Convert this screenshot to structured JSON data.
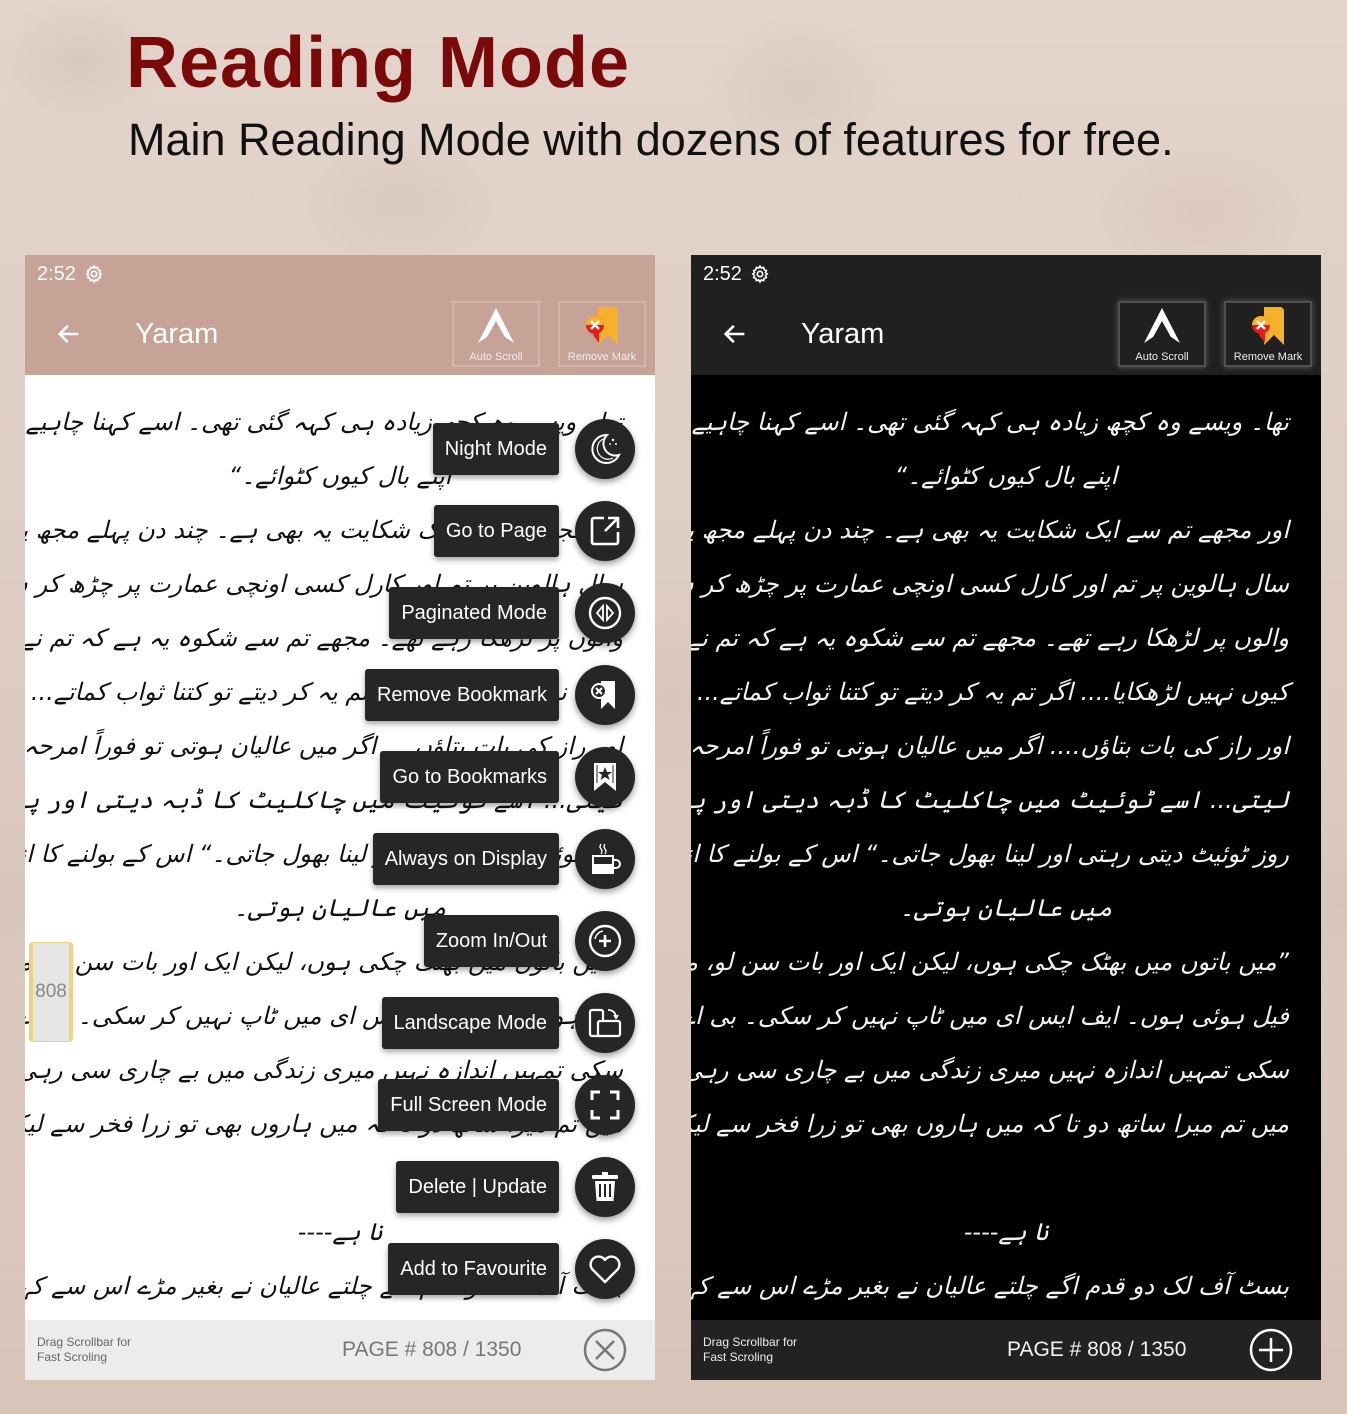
{
  "promo": {
    "headline": "Reading Mode",
    "subline": "Main Reading Mode with dozens of features for free."
  },
  "colors": {
    "headline": "#7a0a0a",
    "light_toolbar": "#c6a297",
    "dark_toolbar": "#202020",
    "fab_bg": "#262626",
    "scroll_thumb_accent": "#f0cf7e"
  },
  "light_screen": {
    "status": {
      "time": "2:52",
      "icon": "gear-icon"
    },
    "toolbar": {
      "back_icon": "arrow-left-icon",
      "title": "Yaram",
      "auto_scroll_label": "Auto Scroll",
      "remove_mark_label": "Remove Mark"
    },
    "paragraphs": [
      "تھا۔ ویسے وہ کچھ زیادہ ہی کہہ گئی تھی۔ اسے کہنا چاہیے تھا ”کارل کا سر کٹوا دیتے",
      "اپنے بال کیوں کٹوائے۔“",
      "اور مجھے تم سے ایک شکایت یہ بھی ہے۔ چند دن پہلے مجھ پر انکشاف ہوا کہ پچھلے",
      "سال ہالوین پر تم اور کارل کسی اونچی عمارت پر چڑھ کر ہالوین کدو آنے جانے",
      "والوں پر لڑھکا رہے تھے۔ مجھے تم سے شکوہ یہ ہے کہ تم نے کارل کو اوپر سے نیچے",
      "کیوں نہیں لڑھکایا.... اگر تم یہ کر دیتے تو کتنا ثواب کماتے... ویسے عالیان ایک",
      "اور راز کی بات بتاؤں.... اگر میں عالیان ہوتی تو فوراً امرحہ سے دوستی کر",
      "لیتی... اسے ٹوئیٹ میں چاکلیٹ کا ڈبہ دیتی اور پھر یہ ٹوئیٹ واپس بھی نہ لیتی اور ہر",
      "روز ٹوئیٹ دیتی رہتی اور لینا بھول جاتی۔“ اس کے بولنے کا انداز قابل دید تھا۔ اگر",
      "میں عالیان ہوتی۔",
      "”میں باتوں میں بھٹک چکی ہوں، لیکن ایک اور بات سن لو، میں زندگی میں بہت بار",
      "فیل ہوئی ہوں۔ ایف ایس ای میں ٹاپ نہیں کر سکی۔ بی اے میں پلس نہیں لے",
      "سکی تمہیں اندازہ نہیں میری زندگی میں بے چاری سی رہی اب میرا دل ہے مشق",
      "میں تم میرا ساتھ دو تا کہ میں ہاروں بھی تو زرا فخر سے لیکن شاید تم مجھے جتوا ہی دو",
      "نا ہے----",
      "بسٹ آف لک دو قدم اگے چلتے عالیان نے بغیر مڑے اس سے کہا اور چاکلیٹ"
    ],
    "scrollbar_page": "808",
    "bottom": {
      "hint": "Drag Scrollbar for Fast Scroling",
      "page_label": "PAGE # 808 / 1350",
      "action_icon": "close-circle-icon"
    },
    "fab_menu": [
      {
        "label": "Night Mode",
        "icon": "moon-icon"
      },
      {
        "label": "Go to Page",
        "icon": "open-external-icon"
      },
      {
        "label": "Paginated Mode",
        "icon": "paginate-arrows-icon"
      },
      {
        "label": "Remove Bookmark",
        "icon": "bookmark-remove-icon"
      },
      {
        "label": "Go to Bookmarks",
        "icon": "bookmark-star-icon"
      },
      {
        "label": "Always on Display",
        "icon": "coffee-cup-icon"
      },
      {
        "label": "Zoom In/Out",
        "icon": "zoom-plus-icon"
      },
      {
        "label": "Landscape Mode",
        "icon": "rotate-screen-icon"
      },
      {
        "label": "Full Screen Mode",
        "icon": "fullscreen-icon"
      },
      {
        "label": "Delete | Update",
        "icon": "trash-icon"
      },
      {
        "label": "Add to Favourite",
        "icon": "heart-icon"
      }
    ]
  },
  "dark_screen": {
    "status": {
      "time": "2:52",
      "icon": "gear-icon"
    },
    "toolbar": {
      "back_icon": "arrow-left-icon",
      "title": "Yaram",
      "auto_scroll_label": "Auto Scroll",
      "remove_mark_label": "Remove Mark"
    },
    "paragraphs": [
      "تھا۔ ویسے وہ کچھ زیادہ ہی کہہ گئی تھی۔ اسے کہنا چاہیے تھا ”کارل کا سر کٹوا دیتے",
      "اپنے بال کیوں کٹوائے۔“",
      "اور مجھے تم سے ایک شکایت یہ بھی ہے۔ چند دن پہلے مجھ پر انکشاف ہوا کہ پچھلے",
      "سال ہالوین پر تم اور کارل کسی اونچی عمارت پر چڑھ کر ہالوین کدو آنے جانے",
      "والوں پر لڑھکا رہے تھے۔ مجھے تم سے شکوہ یہ ہے کہ تم نے کارل کو اوپر سے نیچے",
      "کیوں نہیں لڑھکایا.... اگر تم یہ کر دیتے تو کتنا ثواب کماتے... ویسے عالیان ایک",
      "اور راز کی بات بتاؤں.... اگر میں عالیان ہوتی تو فوراً امرحہ سے دوستی کر",
      "لیتی... اسے ٹوئیٹ میں چاکلیٹ کا ڈبہ دیتی اور پھر یہ ٹوئیٹ واپس بھی نہ لیتی اور ہر",
      "روز ٹوئیٹ دیتی رہتی اور لینا بھول جاتی۔“ اس کے بولنے کا انداز قابل دید تھا۔ اگر",
      "میں عالیان ہوتی۔",
      "”میں باتوں میں بھٹک چکی ہوں، لیکن ایک اور بات سن لو، میں زندگی میں بہت بار",
      "فیل ہوئی ہوں۔ ایف ایس ای میں ٹاپ نہیں کر سکی۔ بی اے میں پلس نہیں لے",
      "سکی تمہیں اندازہ نہیں میری زندگی میں بے چاری سی رہی اب میرا دل ہے مشق",
      "میں تم میرا ساتھ دو تا کہ میں ہاروں بھی تو زرا فخر سے لیکن شاید تم مجھے جتوا ہی دو",
      "نا ہے----",
      "بسٹ آف لک دو قدم اگے چلتے عالیان نے بغیر مڑے اس سے کہا اور چاکلیٹ"
    ],
    "bottom": {
      "hint": "Drag Scrollbar for Fast Scroling",
      "page_label": "PAGE # 808 / 1350",
      "action_icon": "plus-circle-icon"
    }
  }
}
